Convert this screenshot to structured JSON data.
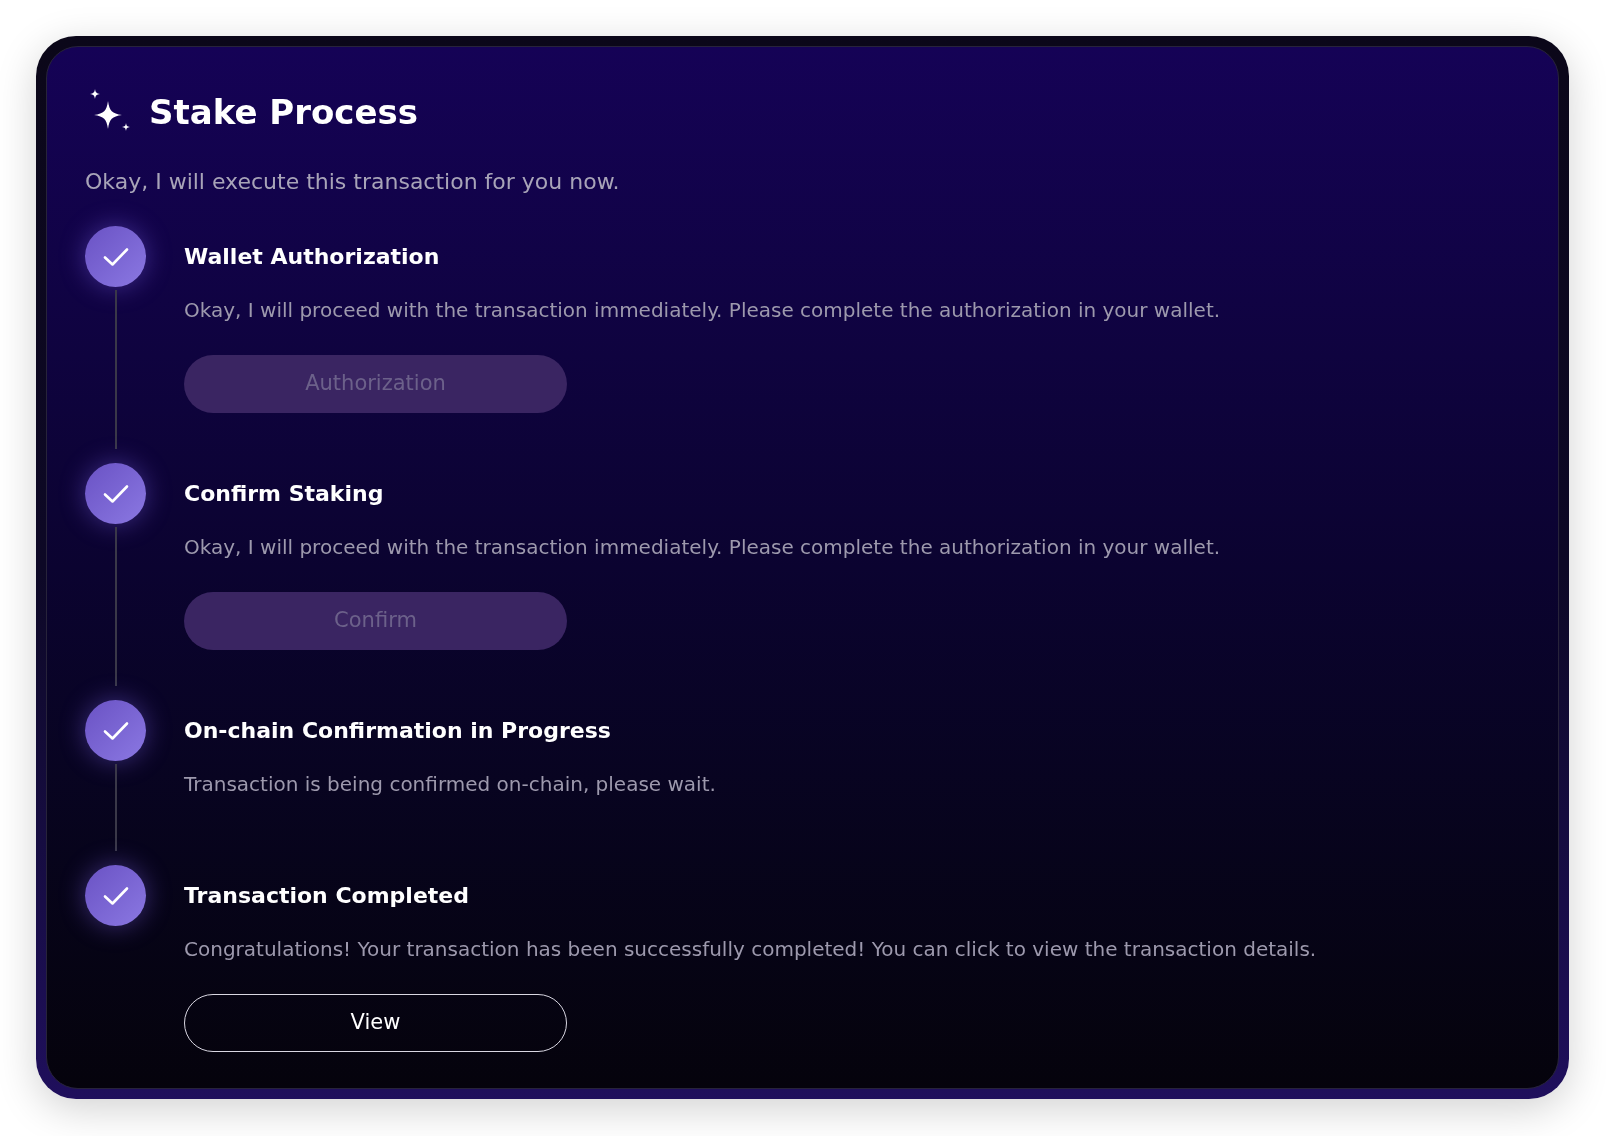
{
  "header": {
    "title": "Stake Process"
  },
  "intro": "Okay, I will execute this transaction for you now.",
  "steps": [
    {
      "title": "Wallet Authorization",
      "completed": true,
      "description": "Okay, I will proceed with the transaction immediately. Please complete the authorization in your wallet.",
      "button": {
        "label": "Authorization",
        "disabled": true
      }
    },
    {
      "title": "Confirm Staking",
      "completed": true,
      "description": "Okay, I will proceed with the transaction immediately. Please complete the authorization in your wallet.",
      "button": {
        "label": "Confirm",
        "disabled": true
      }
    },
    {
      "title": "On-chain Confirmation in Progress",
      "completed": true,
      "description": "Transaction is being confirmed on-chain, please wait."
    },
    {
      "title": "Transaction Completed",
      "completed": true,
      "description": "Congratulations! Your transaction has been successfully completed! You can click to view the transaction details.",
      "button": {
        "label": "View",
        "disabled": false
      }
    }
  ]
}
